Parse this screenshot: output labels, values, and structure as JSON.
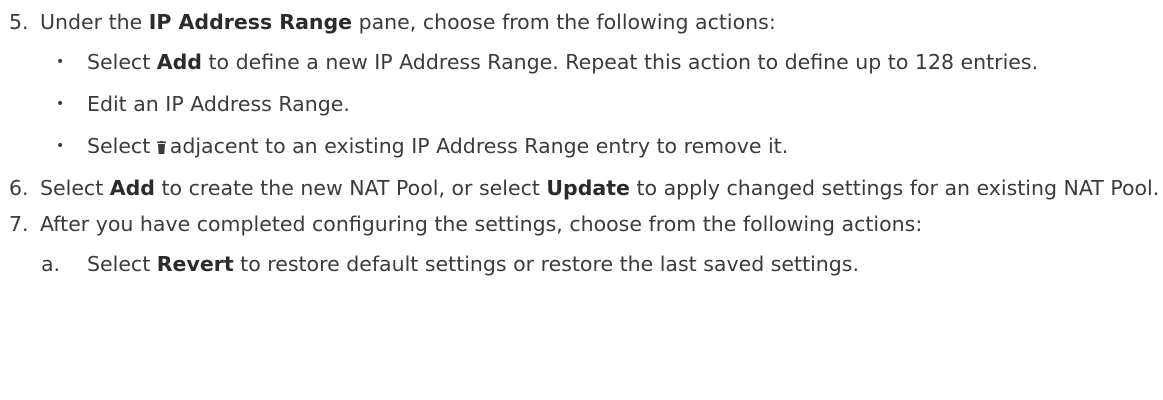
{
  "steps": [
    {
      "num": "5.",
      "pre": "Under the ",
      "bold": "IP Address Range",
      "post": " pane, choose from the following actions:",
      "bullets": [
        {
          "pre": "Select ",
          "bold": "Add",
          "post": " to define a new IP Address Range. Repeat this action to define up to 128 entries."
        },
        {
          "text": "Edit an IP Address Range."
        },
        {
          "pre": "Select ",
          "icon": "trash-icon",
          "post": "adjacent to an existing IP Address Range entry to remove it."
        }
      ]
    },
    {
      "num": "6.",
      "pre": "Select ",
      "bold": "Add",
      "mid": " to create the new NAT Pool, or select ",
      "bold2": "Update",
      "post": " to apply changed settings for an existing NAT Pool."
    },
    {
      "num": "7.",
      "text": "After you have completed configuring the settings, choose from the following actions:",
      "subitems": [
        {
          "letter": "a.",
          "pre": "Select ",
          "bold": "Revert",
          "post": " to restore default settings or restore the last saved settings."
        }
      ]
    }
  ],
  "bullet_glyph": "•"
}
